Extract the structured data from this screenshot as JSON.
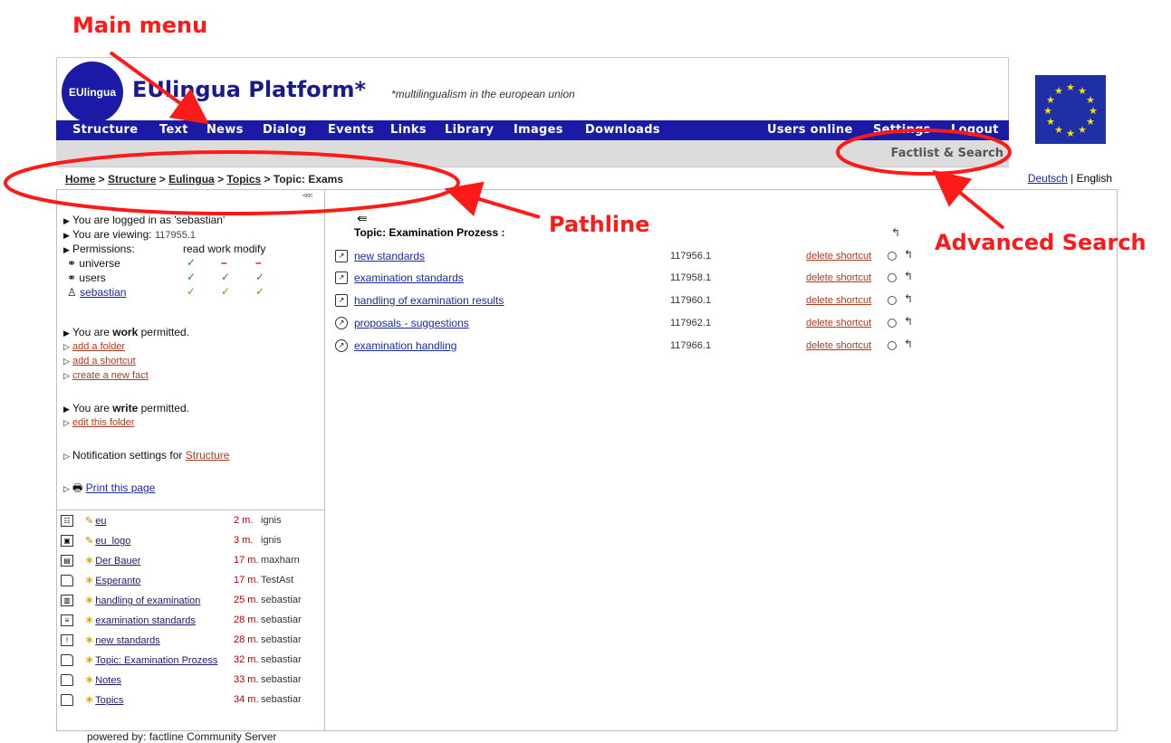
{
  "annotations": {
    "main_menu": "Main menu",
    "pathline": "Pathline",
    "advanced_search": "Advanced Search"
  },
  "header": {
    "logo_text": "EUlingua",
    "brand": "EUlingua Platform*",
    "tagline": "*multilingualism in the european union"
  },
  "menu": {
    "items": [
      "Structure",
      "Text",
      "News",
      "Dialog",
      "Events",
      "Links",
      "Library",
      "Images",
      "Downloads"
    ],
    "right_items": [
      "Users online",
      "Settings",
      "Logout"
    ],
    "factlist_search": "Factlist & Search"
  },
  "pathline": {
    "home": "Home",
    "sep": " > ",
    "structure": "Structure",
    "eulingua": "Eulingua",
    "topics": "Topics",
    "current": "Topic: Exams"
  },
  "languages": {
    "deutsch": "Deutsch",
    "separator": " | ",
    "english": "English"
  },
  "sidebar": {
    "collapse_icon": "<<<",
    "logged_in": "You are logged in as 'sebastian'",
    "viewing_label": "You are viewing:",
    "viewing_id": "117955.1",
    "permissions_label": "Permissions:",
    "perm_headers": "read work modify",
    "perm_rows": [
      {
        "name": "universe"
      },
      {
        "name": "users"
      },
      {
        "name": "sebastian"
      }
    ],
    "work_prefix": "You are ",
    "work_bold": "work",
    "work_suffix": " permitted.",
    "add_folder": "add a folder",
    "add_shortcut": "add a shortcut",
    "create_fact": "create a new fact",
    "write_prefix": "You are ",
    "write_bold": "write",
    "write_suffix": " permitted.",
    "edit_folder": "edit this folder",
    "notification_prefix": "Notification settings for ",
    "notification_link": "Structure",
    "print_page": "Print this page"
  },
  "recent": [
    {
      "name": "eu",
      "time": "2 m.",
      "user": "ignis",
      "icon": "list-icon",
      "mark": "pencil"
    },
    {
      "name": "eu_logo",
      "time": "3 m.",
      "user": "ignis",
      "icon": "image-icon",
      "mark": "pencil"
    },
    {
      "name": "Der Bauer",
      "time": "17 m.",
      "user": "maxharn",
      "icon": "doc-icon",
      "mark": "star"
    },
    {
      "name": "Esperanto",
      "time": "17 m.",
      "user": "TestAst",
      "icon": "folder-icon",
      "mark": "star"
    },
    {
      "name": "handling of examination",
      "time": "25 m.",
      "user": "sebastiar",
      "icon": "book-icon",
      "mark": "star"
    },
    {
      "name": "examination standards",
      "time": "28 m.",
      "user": "sebastiar",
      "icon": "text-icon",
      "mark": "star"
    },
    {
      "name": "new standards",
      "time": "28 m.",
      "user": "sebastiar",
      "icon": "alert-icon",
      "mark": "star"
    },
    {
      "name": "Topic: Examination Prozess",
      "time": "32 m.",
      "user": "sebastiar",
      "icon": "folder-icon",
      "mark": "star"
    },
    {
      "name": "Notes",
      "time": "33 m.",
      "user": "sebastiar",
      "icon": "folder-icon",
      "mark": "star"
    },
    {
      "name": "Topics",
      "time": "34 m.",
      "user": "sebastiar",
      "icon": "folder-icon",
      "mark": "star"
    }
  ],
  "content": {
    "up_arrow": "⇚",
    "title": "Topic: Examination Prozess :",
    "back_icon": "↰",
    "rows": [
      {
        "name": "new standards",
        "id": "117956.1",
        "action": "delete shortcut"
      },
      {
        "name": "examination standards",
        "id": "117958.1",
        "action": "delete shortcut"
      },
      {
        "name": "handling of examination results",
        "id": "117960.1",
        "action": "delete shortcut"
      },
      {
        "name": "proposals - suggestions",
        "id": "117962.1",
        "action": "delete shortcut"
      },
      {
        "name": "examination handling",
        "id": "117966.1",
        "action": "delete shortcut"
      }
    ]
  },
  "footer": {
    "powered": "powered by: factline Community Server"
  },
  "colors": {
    "menu_bg": "#1a1aa6",
    "annotation": "#ff1a1a",
    "link": "#1a2a9c",
    "action_link": "#b23a1a"
  }
}
